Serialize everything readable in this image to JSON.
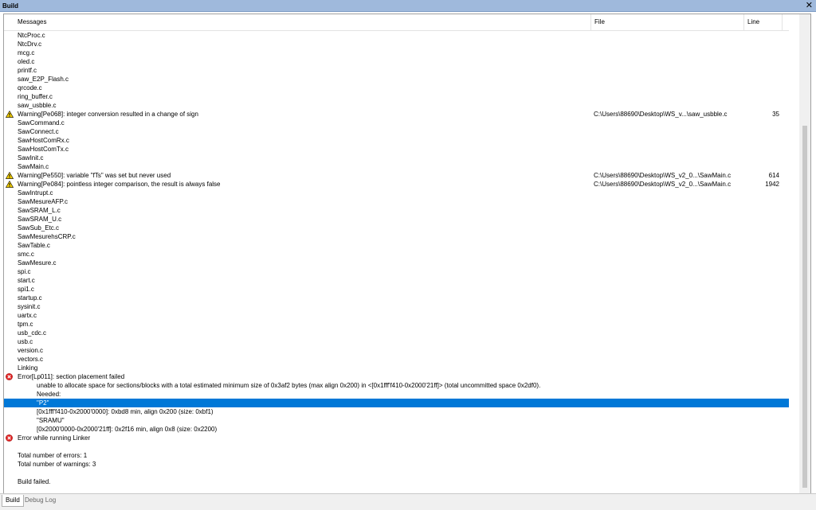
{
  "window": {
    "title": "Build",
    "close_symbol": "✕"
  },
  "columns": {
    "messages": "Messages",
    "file": "File",
    "line": "Line"
  },
  "rows": [
    {
      "msg": "NtcProc.c"
    },
    {
      "msg": "NtcDrv.c"
    },
    {
      "msg": "mcg.c"
    },
    {
      "msg": "oled.c"
    },
    {
      "msg": "printf.c"
    },
    {
      "msg": "saw_E2P_Flash.c"
    },
    {
      "msg": "qrcode.c"
    },
    {
      "msg": "ring_buffer.c"
    },
    {
      "msg": "saw_usbble.c"
    },
    {
      "msg": "Warning[Pe068]: integer conversion resulted in a change of sign",
      "file": "C:\\Users\\88690\\Desktop\\WS_v...\\saw_usbble.c",
      "line": "35",
      "icon": "warning-icon"
    },
    {
      "msg": "SawCommand.c"
    },
    {
      "msg": "SawConnect.c"
    },
    {
      "msg": "SawHostComRx.c"
    },
    {
      "msg": "SawHostComTx.c"
    },
    {
      "msg": "SawInit.c"
    },
    {
      "msg": "SawMain.c"
    },
    {
      "msg": "Warning[Pe550]: variable \"fTs\" was set but never used",
      "file": "C:\\Users\\88690\\Desktop\\WS_v2_0...\\SawMain.c",
      "line": "614",
      "icon": "warning-icon"
    },
    {
      "msg": "Warning[Pe084]: pointless integer comparison, the result is always false",
      "file": "C:\\Users\\88690\\Desktop\\WS_v2_0...\\SawMain.c",
      "line": "1942",
      "icon": "warning-icon"
    },
    {
      "msg": "SawIntrupt.c"
    },
    {
      "msg": "SawMesureAFP.c"
    },
    {
      "msg": "SawSRAM_L.c"
    },
    {
      "msg": "SawSRAM_U.c"
    },
    {
      "msg": "SawSub_Etc.c"
    },
    {
      "msg": "SawMesurehsCRP.c"
    },
    {
      "msg": "SawTable.c"
    },
    {
      "msg": "smc.c"
    },
    {
      "msg": "SawMesure.c"
    },
    {
      "msg": "spi.c"
    },
    {
      "msg": "start.c"
    },
    {
      "msg": "spi1.c"
    },
    {
      "msg": "startup.c"
    },
    {
      "msg": "sysinit.c"
    },
    {
      "msg": "uartx.c"
    },
    {
      "msg": "tpm.c"
    },
    {
      "msg": "usb_cdc.c"
    },
    {
      "msg": "usb.c"
    },
    {
      "msg": "version.c"
    },
    {
      "msg": "vectors.c"
    },
    {
      "msg": "Linking"
    },
    {
      "msg": "Error[Lp011]: section placement failed",
      "icon": "error-icon"
    },
    {
      "msg": "unable to allocate space for sections/blocks with a total estimated minimum size of 0x3af2 bytes (max align 0x200) in <[0x1fff'f410-0x2000'21ff]> (total uncommitted space 0x2df0).",
      "indent": true
    },
    {
      "msg": "Needed:",
      "indent": true
    },
    {
      "msg": "\"P2\"",
      "indent": true,
      "selected": true
    },
    {
      "msg": "[0x1fff'f410-0x2000'0000]:  0xbd8 min, align 0x200 (size:  0xbf1)",
      "indent": true
    },
    {
      "msg": "\"SRAMU\"",
      "indent": true
    },
    {
      "msg": "[0x2000'0000-0x2000'21ff]: 0x2f16 min, align   0x8 (size: 0x2200)",
      "indent": true
    },
    {
      "msg": "Error while running Linker",
      "icon": "error-icon"
    },
    {
      "msg": ""
    },
    {
      "msg": "Total number of errors: 1"
    },
    {
      "msg": "Total number of warnings: 3"
    },
    {
      "msg": ""
    },
    {
      "msg": "Build failed."
    }
  ],
  "tabs": [
    {
      "label": "Build",
      "active": true
    },
    {
      "label": "Debug Log",
      "active": false
    }
  ],
  "colors": {
    "selection": "#0078d7",
    "titlebar": "#9fb9dc",
    "warning": "#f5d000",
    "error": "#e02020"
  }
}
